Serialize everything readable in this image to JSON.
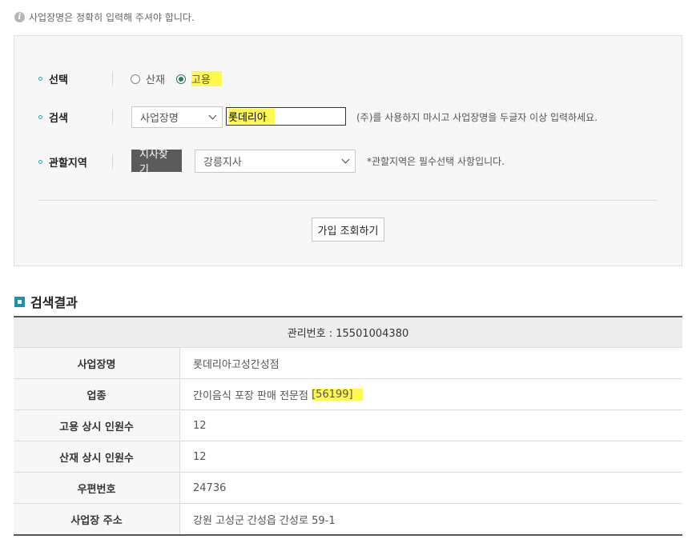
{
  "notice": {
    "icon": "info-icon",
    "text": "사업장명은 정확히 입력해 주셔야 합니다."
  },
  "form": {
    "select_row": {
      "label": "선택",
      "options": [
        {
          "label": "산재",
          "checked": false
        },
        {
          "label": "고용",
          "checked": true
        }
      ]
    },
    "search_row": {
      "label": "검색",
      "type_value": "사업장명",
      "input_value": "롯데리아",
      "hint": "(주)를 사용하지 마시고 사업장명을 두글자 이상 입력하세요."
    },
    "region_row": {
      "label": "관할지역",
      "find_button": "지사찾기",
      "region_value": "강릉지사",
      "hint": "*관할지역은 필수선택 사항입니다."
    },
    "submit_button": "가입 조회하기"
  },
  "results": {
    "title": "검색결과",
    "header": "관리번호 : 15501004380",
    "rows": [
      {
        "key": "사업장명",
        "value": "롯데리아고성간성점"
      },
      {
        "key": "업종",
        "value": "간이음식 포장 판매 전문점",
        "code": "[56199]"
      },
      {
        "key": "고용 상시 인원수",
        "value": "12"
      },
      {
        "key": "산재 상시 인원수",
        "value": "12"
      },
      {
        "key": "우편번호",
        "value": "24736"
      },
      {
        "key": "사업장 주소",
        "value": "강원 고성군 간성읍 간성로 59-1"
      }
    ]
  },
  "colors": {
    "accent": "#1c8fb3",
    "highlight": "#fff94f",
    "radio_checked": "#2a7d59"
  }
}
